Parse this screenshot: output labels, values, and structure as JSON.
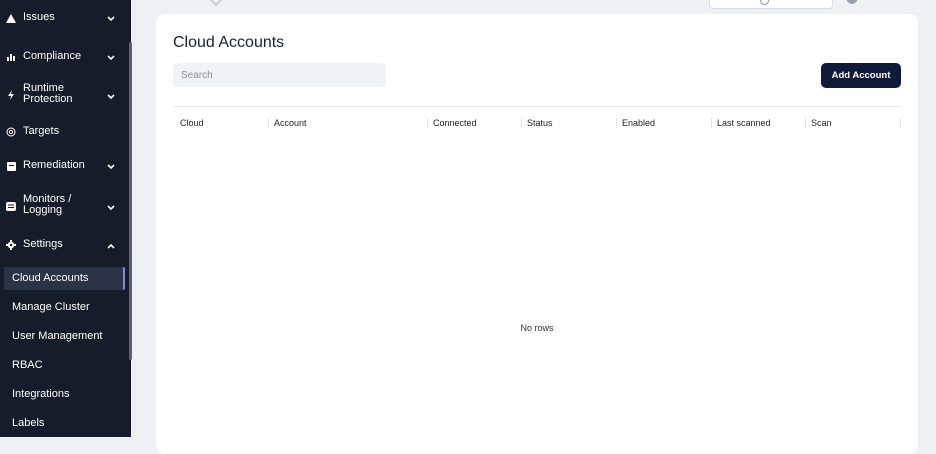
{
  "sidebar": {
    "items": [
      {
        "label": "Issues",
        "icon": "warning-triangle-icon",
        "chevron": "down"
      },
      {
        "label": "Compliance",
        "icon": "bar-chart-icon",
        "chevron": "down"
      },
      {
        "label": "Runtime\nProtection",
        "icon": "lightning-bolt-icon",
        "chevron": "down"
      },
      {
        "label": "Targets",
        "icon": "target-icon",
        "chevron": ""
      },
      {
        "label": "Remediation",
        "icon": "clipboard-icon",
        "chevron": "down"
      },
      {
        "label": "Monitors /\nLogging",
        "icon": "monitor-icon",
        "chevron": "down"
      },
      {
        "label": "Settings",
        "icon": "gear-icon",
        "chevron": "up"
      }
    ],
    "settings_children": [
      "Cloud Accounts",
      "Manage Cluster",
      "User Management",
      "RBAC",
      "Integrations",
      "Labels"
    ],
    "active": "Cloud Accounts"
  },
  "main": {
    "title": "Cloud Accounts",
    "search_placeholder": "Search",
    "add_button_label": "Add Account",
    "columns": [
      "Cloud",
      "Account",
      "Connected",
      "Status",
      "Enabled",
      "Last scanned",
      "Scan"
    ],
    "empty_text": "No rows"
  },
  "colors": {
    "sidebar_bg": "#161c2a",
    "primary_button": "#0f1a3d",
    "active_item_bg": "#2b3346",
    "active_item_border": "#8a86d8",
    "page_bg": "#eef0f3"
  }
}
